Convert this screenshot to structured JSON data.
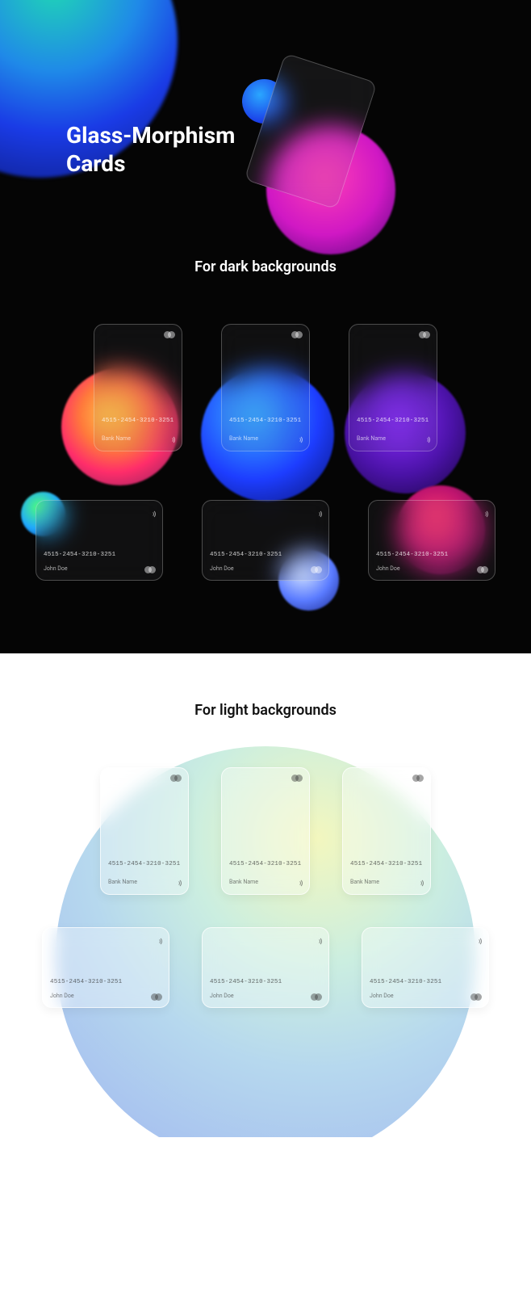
{
  "hero": {
    "title": "Glass-Morphism Cards"
  },
  "sections": {
    "dark_title": "For dark backgrounds",
    "light_title": "For light backgrounds"
  },
  "card_values": {
    "number": "4515-2454-3210-3251",
    "bank_label": "Bank Name",
    "holder": "John Doe"
  }
}
